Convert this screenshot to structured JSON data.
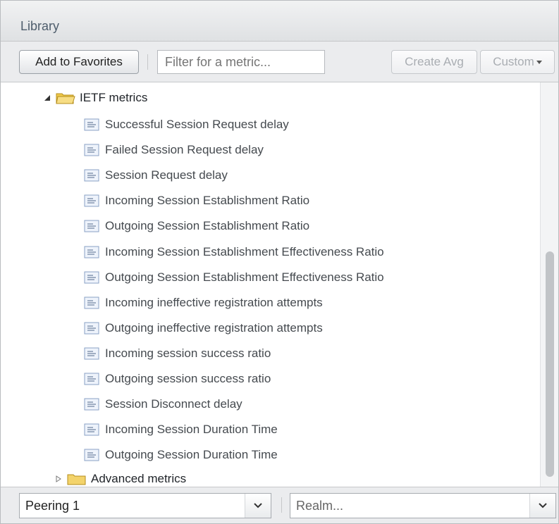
{
  "title": "Library",
  "toolbar": {
    "add_favorites_label": "Add to Favorites",
    "filter_placeholder": "Filter for a metric...",
    "create_avg_label": "Create Avg",
    "custom_label": "Custom"
  },
  "tree": {
    "open_folder": "IETF metrics",
    "metrics": [
      "Successful Session Request delay",
      "Failed Session Request delay",
      "Session Request delay",
      "Incoming Session Establishment Ratio",
      "Outgoing Session Establishment Ratio",
      "Incoming Session Establishment Effectiveness Ratio",
      "Outgoing Session Establishment Effectiveness Ratio",
      "Incoming ineffective registration attempts",
      "Outgoing ineffective registration attempts",
      "Incoming session success ratio",
      "Outgoing session success ratio",
      "Session Disconnect delay",
      "Incoming Session Duration Time",
      "Outgoing Session Duration Time"
    ],
    "closed_folder": "Advanced metrics"
  },
  "bottom": {
    "peering_value": "Peering 1",
    "realm_placeholder": "Realm..."
  },
  "colors": {
    "folder": "#f3d36b",
    "panel_border": "#b9bcbf",
    "toolbar_bg": "#ebecee"
  }
}
